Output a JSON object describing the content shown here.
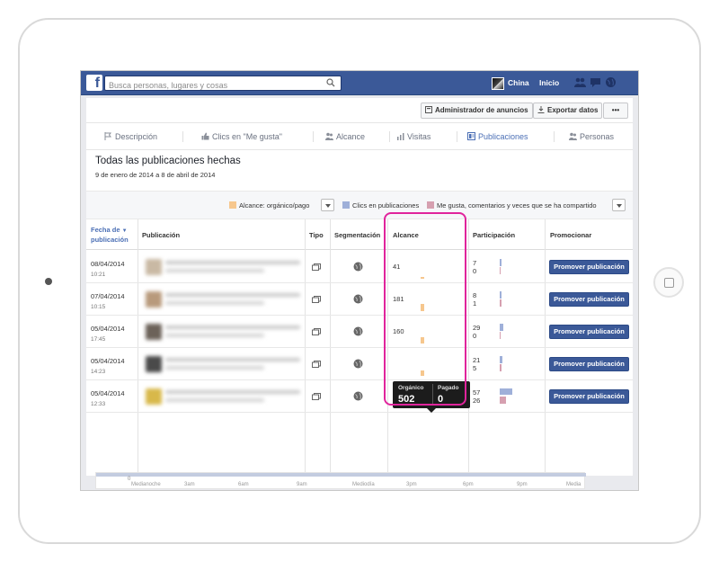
{
  "topbar": {
    "logo": "f",
    "search_placeholder": "Busca personas, lugares y cosas",
    "user_name": "China",
    "home_label": "Inicio"
  },
  "toolbar": {
    "ads_manager": "Administrador de anuncios",
    "export": "Exportar datos",
    "more": "•••"
  },
  "tabs": [
    {
      "label": "Descripción",
      "icon": "flag-icon"
    },
    {
      "label": "Clics en \"Me gusta\"",
      "icon": "thumbs-up-icon"
    },
    {
      "label": "Alcance",
      "icon": "people-icon"
    },
    {
      "label": "Visitas",
      "icon": "bar-chart-icon"
    },
    {
      "label": "Publicaciones",
      "icon": "posts-icon",
      "active": true
    },
    {
      "label": "Personas",
      "icon": "people-icon"
    }
  ],
  "header": {
    "title": "Todas las publicaciones hechas",
    "date_range": "9 de enero de 2014 a 8 de abril de 2014"
  },
  "filters": {
    "reach_legend": "Alcance: orgánico/pago",
    "clicks_legend": "Clics en publicaciones",
    "likes_legend": "Me gusta, comentarios y veces que se ha compartido",
    "colors": {
      "reach": "#f6c78e",
      "clicks": "#9fb0d9",
      "likes": "#d6a0b0"
    }
  },
  "table": {
    "headers": {
      "date_line1": "Fecha de",
      "date_line2": "publicación",
      "post": "Publicación",
      "type": "Tipo",
      "targeting": "Segmentación",
      "reach": "Alcance",
      "engagement": "Participación",
      "promote": "Promocionar"
    },
    "rows": [
      {
        "date": "08/04/2014",
        "time": "10:21",
        "reach": "41",
        "eng1": "7",
        "eng2": "0",
        "reach_frac": 0.08,
        "clicks_frac": 0.13,
        "likes_frac": 0.0,
        "thumb": "#c9b9a4"
      },
      {
        "date": "07/04/2014",
        "time": "10:15",
        "reach": "181",
        "eng1": "8",
        "eng2": "1",
        "reach_frac": 0.36,
        "clicks_frac": 0.14,
        "likes_frac": 0.02,
        "thumb": "#b89a7c"
      },
      {
        "date": "05/04/2014",
        "time": "17:45",
        "reach": "160",
        "eng1": "29",
        "eng2": "0",
        "reach_frac": 0.32,
        "clicks_frac": 0.51,
        "likes_frac": 0.0,
        "thumb": "#6c6259"
      },
      {
        "date": "05/04/2014",
        "time": "14:23",
        "reach": "",
        "eng1": "21",
        "eng2": "5",
        "reach_frac": 0.28,
        "clicks_frac": 0.37,
        "likes_frac": 0.09,
        "thumb": "#4a4a4a"
      },
      {
        "date": "05/04/2014",
        "time": "12:33",
        "reach": "502",
        "eng1": "57",
        "eng2": "26",
        "reach_frac": 1.0,
        "clicks_frac": 1.0,
        "likes_frac": 0.46,
        "thumb": "#d8b84a"
      }
    ],
    "promote_label": "Promover publicación"
  },
  "tooltip": {
    "organic_label": "Orgánico",
    "organic_value": "502",
    "paid_label": "Pagado",
    "paid_value": "0"
  },
  "timeline": {
    "zero": "0",
    "labels": [
      "Medianoche",
      "3am",
      "6am",
      "9am",
      "Mediodía",
      "3pm",
      "6pm",
      "9pm",
      "Media"
    ]
  },
  "accent": {
    "highlight": "#e0249c",
    "brand": "#3b5998"
  }
}
